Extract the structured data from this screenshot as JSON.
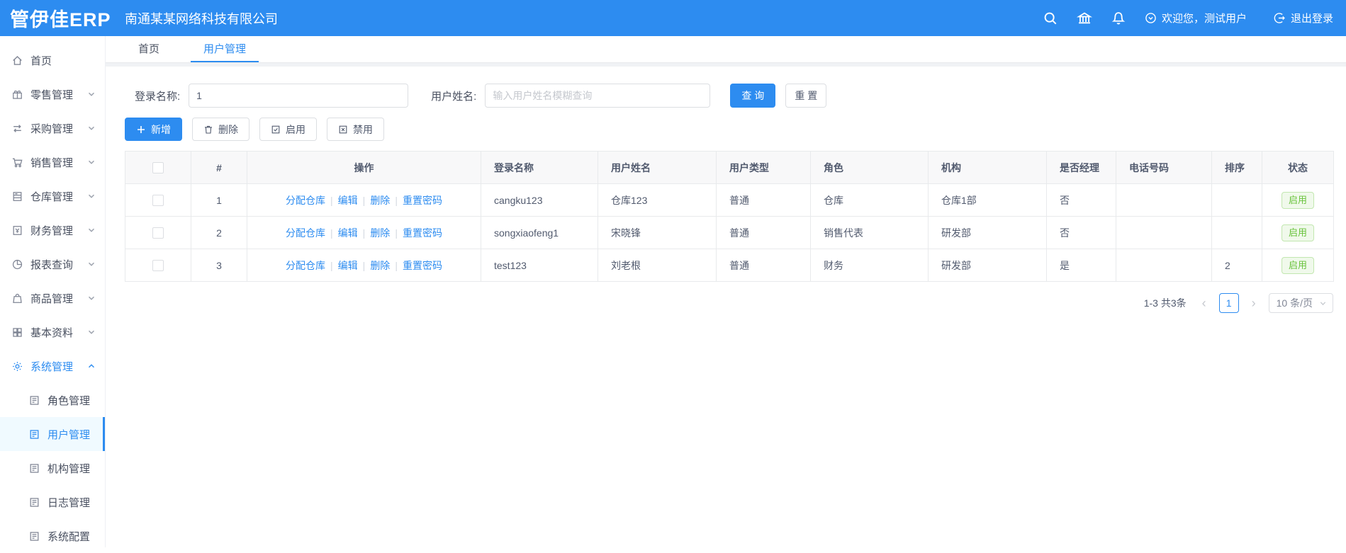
{
  "colors": {
    "accent": "#2d8cf0",
    "success_text": "#67c23a",
    "success_border": "#c2e7b0",
    "success_bg": "#f0f9eb"
  },
  "topbar": {
    "logo": "管伊佳ERP",
    "company": "南通某某网络科技有限公司",
    "welcome": "欢迎您，测试用户",
    "logout": "退出登录"
  },
  "sidebar": {
    "items": [
      {
        "label": "首页"
      },
      {
        "label": "零售管理"
      },
      {
        "label": "采购管理"
      },
      {
        "label": "销售管理"
      },
      {
        "label": "仓库管理"
      },
      {
        "label": "财务管理"
      },
      {
        "label": "报表查询"
      },
      {
        "label": "商品管理"
      },
      {
        "label": "基本资料"
      },
      {
        "label": "系统管理"
      }
    ],
    "sub_items": [
      {
        "label": "角色管理"
      },
      {
        "label": "用户管理"
      },
      {
        "label": "机构管理"
      },
      {
        "label": "日志管理"
      },
      {
        "label": "系统配置"
      }
    ]
  },
  "tabs": {
    "items": [
      {
        "label": "首页"
      },
      {
        "label": "用户管理"
      }
    ]
  },
  "search": {
    "login_label": "登录名称:",
    "login_value": "1",
    "name_label": "用户姓名:",
    "name_placeholder": "输入用户姓名模糊查询",
    "query_label": "查 询",
    "reset_label": "重 置"
  },
  "toolbar": {
    "add": "新增",
    "remove": "删除",
    "enable": "启用",
    "disable": "禁用"
  },
  "table": {
    "headers": [
      "#",
      "操作",
      "登录名称",
      "用户姓名",
      "用户类型",
      "角色",
      "机构",
      "是否经理",
      "电话号码",
      "排序",
      "状态"
    ],
    "op_labels": [
      "分配仓库",
      "编辑",
      "删除",
      "重置密码"
    ],
    "rows": [
      {
        "index": "1",
        "login": "cangku123",
        "name": "仓库123",
        "type": "普通",
        "role": "仓库",
        "org": "仓库1部",
        "manager": "否",
        "phone": "",
        "sort": "",
        "status": "启用"
      },
      {
        "index": "2",
        "login": "songxiaofeng1",
        "name": "宋晓锋",
        "type": "普通",
        "role": "销售代表",
        "org": "研发部",
        "manager": "否",
        "phone": "",
        "sort": "",
        "status": "启用"
      },
      {
        "index": "3",
        "login": "test123",
        "name": "刘老根",
        "type": "普通",
        "role": "财务",
        "org": "研发部",
        "manager": "是",
        "phone": "",
        "sort": "2",
        "status": "启用"
      }
    ]
  },
  "pagination": {
    "total": "1-3 共3条",
    "current_page": "1",
    "page_size": "10 条/页"
  }
}
